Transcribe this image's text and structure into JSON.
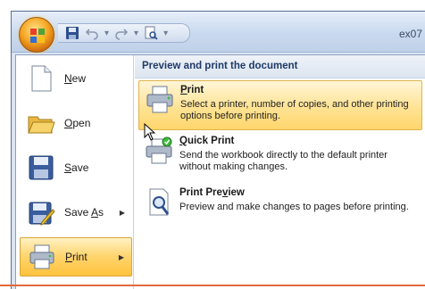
{
  "window": {
    "title_fragment": "ex07"
  },
  "quick_access": {
    "items": [
      "save-icon",
      "undo-icon",
      "redo-icon",
      "print-preview-icon",
      "customize-icon"
    ]
  },
  "menu": {
    "items": [
      {
        "label_prefix": "",
        "label_key": "N",
        "label_rest": "ew",
        "icon": "new-document-icon"
      },
      {
        "label_prefix": "",
        "label_key": "O",
        "label_rest": "pen",
        "icon": "open-folder-icon"
      },
      {
        "label_prefix": "",
        "label_key": "S",
        "label_rest": "ave",
        "icon": "save-disk-icon"
      },
      {
        "label_prefix": "Save ",
        "label_key": "A",
        "label_rest": "s",
        "icon": "save-as-icon",
        "has_arrow": true
      },
      {
        "label_prefix": "",
        "label_key": "P",
        "label_rest": "rint",
        "icon": "printer-icon",
        "has_arrow": true,
        "active": true
      }
    ]
  },
  "submenu": {
    "header": "Preview and print the document",
    "options": [
      {
        "title_key": "P",
        "title_rest": "rint",
        "description": "Select a printer, number of copies, and other printing options before printing.",
        "icon": "printer-icon",
        "highlighted": true
      },
      {
        "title_key": "Q",
        "title_rest": "uick Print",
        "description": "Send the workbook directly to the default printer without making changes.",
        "icon": "quick-print-icon"
      },
      {
        "title_pre": "Print Pre",
        "title_key": "v",
        "title_rest": "iew",
        "description": "Preview and make changes to pages before printing.",
        "icon": "print-preview-icon"
      }
    ]
  },
  "colors": {
    "highlight": "#ffd46b",
    "header_text": "#1e3a66",
    "accent_line": "#e2693b"
  }
}
